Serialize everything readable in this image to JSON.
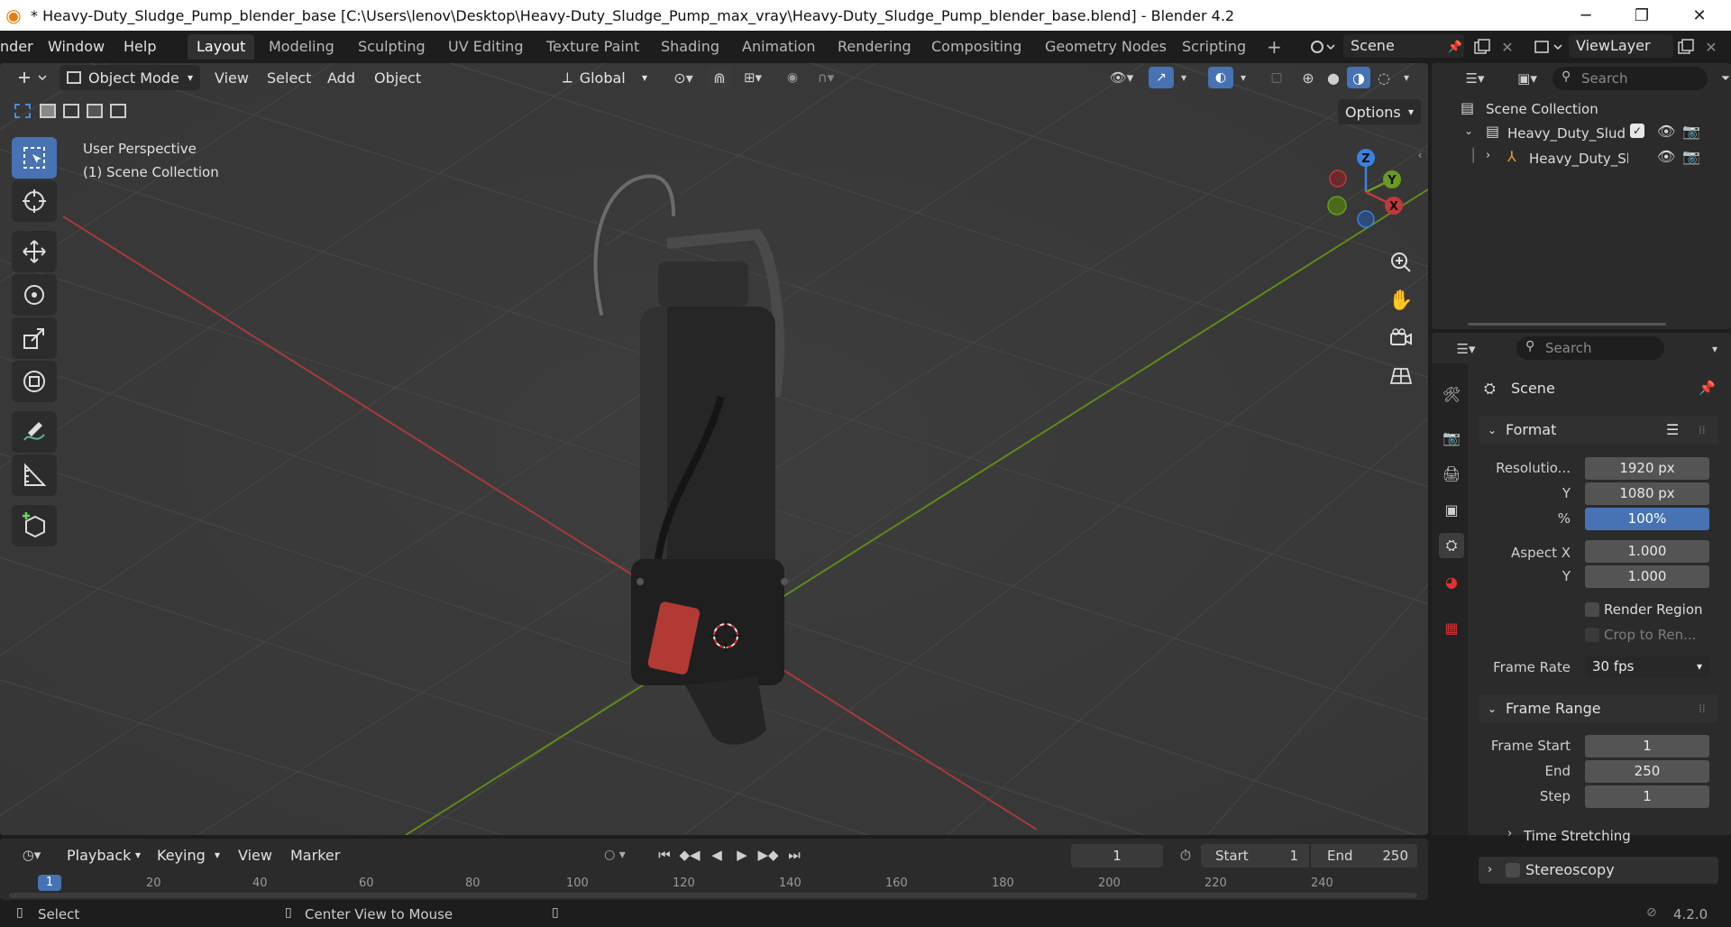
{
  "window": {
    "title": "* Heavy-Duty_Sludge_Pump_blender_base [C:\\Users\\lenov\\Desktop\\Heavy-Duty_Sludge_Pump_max_vray\\Heavy-Duty_Sludge_Pump_blender_base.blend] - Blender 4.2",
    "minimize": "─",
    "restore": "❐",
    "close": "✕"
  },
  "menubar": {
    "items": [
      "nder",
      "Window",
      "Help"
    ],
    "tabs": [
      "Layout",
      "Modeling",
      "Sculpting",
      "UV Editing",
      "Texture Paint",
      "Shading",
      "Animation",
      "Rendering",
      "Compositing",
      "Geometry Nodes",
      "Scripting"
    ],
    "add_tab": "+",
    "scene": "Scene",
    "view_layer": "ViewLayer"
  },
  "viewport": {
    "mode": "Object Mode",
    "menus": [
      "View",
      "Select",
      "Add",
      "Object"
    ],
    "transform_orientation": "Global",
    "options": "Options",
    "perspective_label": "User Perspective",
    "collection_label": "(1) Scene Collection",
    "gizmo": {
      "z": "Z",
      "y": "Y",
      "x": "X"
    }
  },
  "outliner": {
    "search_placeholder": "Search",
    "root": "Scene Collection",
    "collection": "Heavy_Duty_Sludge",
    "object": "Heavy_Duty_Slu"
  },
  "properties": {
    "search_placeholder": "Search",
    "context": "Scene",
    "format": {
      "title": "Format",
      "resolution_label": "Resolutio...",
      "resolution_x": "1920 px",
      "y_label": "Y",
      "resolution_y": "1080 px",
      "pct_label": "%",
      "resolution_pct": "100%",
      "aspect_x_label": "Aspect X",
      "aspect_x": "1.000",
      "aspect_y_label": "Y",
      "aspect_y": "1.000",
      "render_region": "Render Region",
      "crop": "Crop to Ren...",
      "frame_rate_label": "Frame Rate",
      "frame_rate": "30 fps"
    },
    "frame_range": {
      "title": "Frame Range",
      "start_label": "Frame Start",
      "start": "1",
      "end_label": "End",
      "end": "250",
      "step_label": "Step",
      "step": "1"
    },
    "time_stretching": "Time Stretching",
    "stereoscopy": "Stereoscopy"
  },
  "timeline": {
    "menus": [
      "Playback",
      "Keying",
      "View",
      "Marker"
    ],
    "current_frame": "1",
    "start_label": "Start",
    "start": "1",
    "end_label": "End",
    "end": "250",
    "ruler": [
      "1",
      "20",
      "40",
      "60",
      "80",
      "100",
      "120",
      "140",
      "160",
      "180",
      "200",
      "220",
      "240"
    ]
  },
  "statusbar": {
    "select": "Select",
    "center_view": "Center View to Mouse",
    "version": "4.2.0"
  },
  "colors": {
    "accent": "#4772b3",
    "x_axis": "#c0393b",
    "y_axis": "#6a9a1f",
    "z_axis": "#3a80e0"
  }
}
